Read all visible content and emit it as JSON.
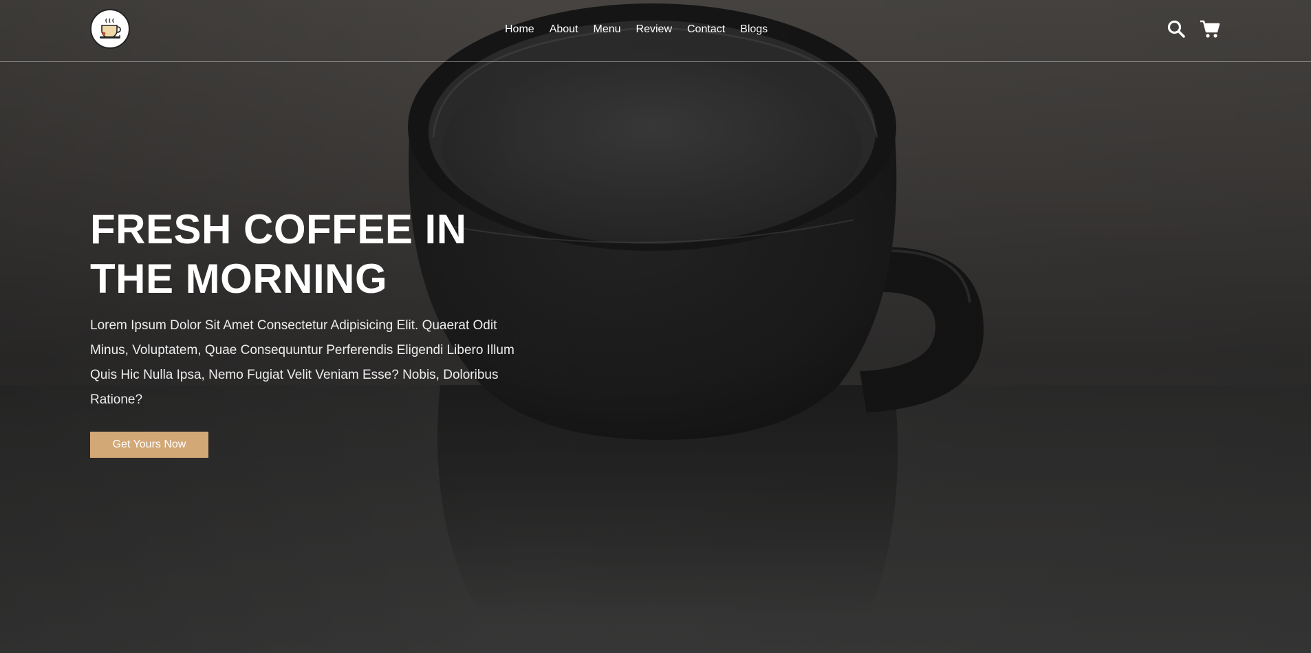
{
  "nav": {
    "items": [
      {
        "label": "Home"
      },
      {
        "label": "About"
      },
      {
        "label": "Menu"
      },
      {
        "label": "Review"
      },
      {
        "label": "Contact"
      },
      {
        "label": "Blogs"
      }
    ]
  },
  "icons": {
    "logo": "coffee-cup-logo",
    "search": "search-icon",
    "cart": "cart-icon"
  },
  "hero": {
    "title_line1": "FRESH COFFEE IN",
    "title_line2": "THE MORNING",
    "text": "Lorem Ipsum Dolor Sit Amet Consectetur Adipisicing Elit. Quaerat Odit Minus, Voluptatem, Quae Consequuntur Perferendis Eligendi Libero Illum Quis Hic Nulla Ipsa, Nemo Fugiat Velit Veniam Esse? Nobis, Doloribus Ratione?",
    "cta_label": "Get Yours Now"
  },
  "colors": {
    "accent": "#d3a877",
    "text": "#ffffff",
    "background": "#2f2e2d"
  }
}
